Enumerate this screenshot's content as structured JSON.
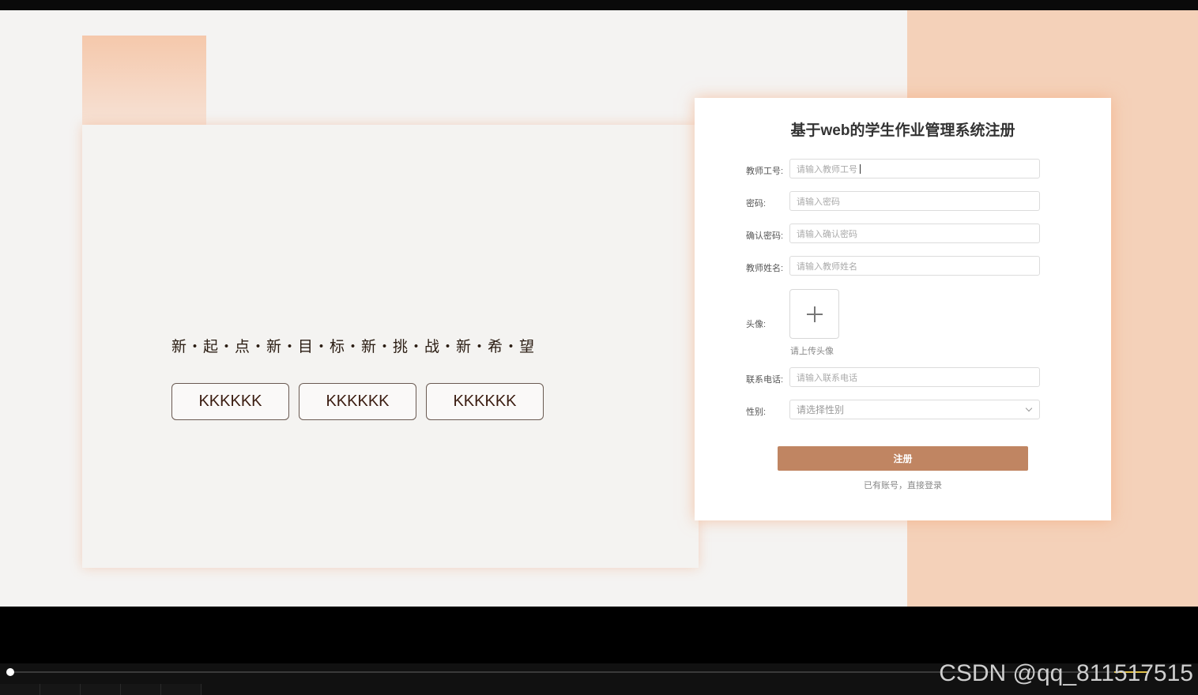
{
  "hero": {
    "slogan": "新・起・点・新・目・标・新・挑・战・新・希・望",
    "buttons": [
      "KKKKKK",
      "KKKKKK",
      "KKKKKK"
    ]
  },
  "form": {
    "title": "基于web的学生作业管理系统注册",
    "fields": [
      {
        "label": "教师工号:",
        "placeholder": "请输入教师工号"
      },
      {
        "label": "密码:",
        "placeholder": "请输入密码"
      },
      {
        "label": "确认密码:",
        "placeholder": "请输入确认密码"
      },
      {
        "label": "教师姓名:",
        "placeholder": "请输入教师姓名"
      }
    ],
    "avatar": {
      "label": "头像:",
      "hint": "请上传头像"
    },
    "phone": {
      "label": "联系电话:",
      "placeholder": "请输入联系电话"
    },
    "gender": {
      "label": "性别:",
      "placeholder": "请选择性别"
    },
    "submit": "注册",
    "login_link": "已有账号，直接登录"
  },
  "player": {
    "progress": 0.005
  },
  "watermark": "CSDN @qq_811517515",
  "colors": {
    "accent": "#c08562",
    "peach": "#f4d1b9",
    "background": "#f4f3f2"
  }
}
